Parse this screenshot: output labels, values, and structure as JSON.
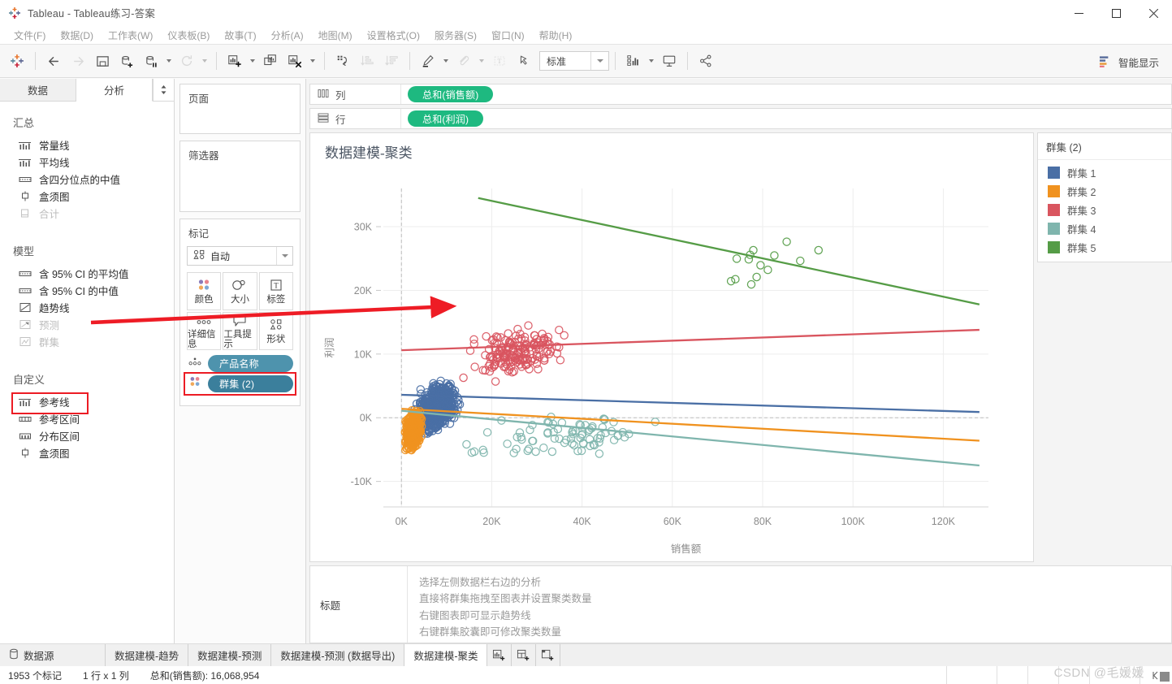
{
  "window": {
    "title": "Tableau - Tableau练习-答案",
    "app_icon": "tableau-icon",
    "minimize": "─",
    "maximize": "☐",
    "close": "✕"
  },
  "menu": [
    {
      "label": "文件(F)"
    },
    {
      "label": "数据(D)"
    },
    {
      "label": "工作表(W)"
    },
    {
      "label": "仪表板(B)"
    },
    {
      "label": "故事(T)"
    },
    {
      "label": "分析(A)"
    },
    {
      "label": "地图(M)"
    },
    {
      "label": "设置格式(O)"
    },
    {
      "label": "服务器(S)"
    },
    {
      "label": "窗口(N)"
    },
    {
      "label": "帮助(H)"
    }
  ],
  "toolbar": {
    "fit_value": "标准",
    "show_me_label": "智能显示",
    "buttons": [
      {
        "name": "tableau-home-icon"
      },
      {
        "name": "undo-icon"
      },
      {
        "name": "redo-icon"
      },
      {
        "name": "save-icon"
      },
      {
        "name": "new-data-source-icon"
      },
      {
        "name": "pause-refresh-icon"
      },
      {
        "name": "refresh-icon"
      },
      {
        "name": "new-worksheet-icon"
      },
      {
        "name": "duplicate-sheet-icon"
      },
      {
        "name": "clear-sheet-icon"
      },
      {
        "name": "swap-axes-icon"
      },
      {
        "name": "sort-ascending-icon"
      },
      {
        "name": "sort-descending-icon"
      },
      {
        "name": "highlight-icon"
      },
      {
        "name": "group-icon"
      },
      {
        "name": "show-labels-icon"
      },
      {
        "name": "fix-axes-icon"
      },
      {
        "name": "presentation-mode-icon"
      },
      {
        "name": "share-icon"
      }
    ]
  },
  "left_pane": {
    "tabs": [
      {
        "label": "数据"
      },
      {
        "label": "分析"
      }
    ],
    "active_tab": "分析",
    "sections": [
      {
        "title": "汇总",
        "items": [
          {
            "label": "常量线",
            "icon": "constant-line-icon",
            "disabled": false
          },
          {
            "label": "平均线",
            "icon": "average-line-icon",
            "disabled": false
          },
          {
            "label": "含四分位点的中值",
            "icon": "median-quartiles-icon",
            "disabled": false
          },
          {
            "label": "盒须图",
            "icon": "box-plot-icon",
            "disabled": false
          },
          {
            "label": "合计",
            "icon": "totals-icon",
            "disabled": true
          }
        ]
      },
      {
        "title": "模型",
        "items": [
          {
            "label": "含 95% CI 的平均值",
            "icon": "average-ci-icon",
            "disabled": false
          },
          {
            "label": "含 95% CI 的中值",
            "icon": "median-ci-icon",
            "disabled": false
          },
          {
            "label": "趋势线",
            "icon": "trend-line-icon",
            "disabled": false
          },
          {
            "label": "预测",
            "icon": "forecast-icon",
            "disabled": true
          },
          {
            "label": "群集",
            "icon": "cluster-icon",
            "disabled": true,
            "highlighted": true
          }
        ]
      },
      {
        "title": "自定义",
        "items": [
          {
            "label": "参考线",
            "icon": "reference-line-icon",
            "disabled": false
          },
          {
            "label": "参考区间",
            "icon": "reference-band-icon",
            "disabled": false
          },
          {
            "label": "分布区间",
            "icon": "distribution-band-icon",
            "disabled": false
          },
          {
            "label": "盒须图",
            "icon": "box-plot-icon",
            "disabled": false
          }
        ]
      }
    ]
  },
  "cards": {
    "pages": {
      "title": "页面"
    },
    "filters": {
      "title": "筛选器"
    },
    "marks": {
      "title": "标记",
      "mark_type": "自动",
      "mark_type_icon": "automatic-marks-icon",
      "buttons": [
        {
          "label": "颜色",
          "icon": "color-icon"
        },
        {
          "label": "大小",
          "icon": "size-icon"
        },
        {
          "label": "标签",
          "icon": "label-icon"
        },
        {
          "label": "详细信息",
          "icon": "detail-icon"
        },
        {
          "label": "工具提示",
          "icon": "tooltip-icon"
        },
        {
          "label": "形状",
          "icon": "shape-icon"
        }
      ],
      "pills": [
        {
          "label": "产品名称",
          "icon": "detail-icon",
          "highlighted": false
        },
        {
          "label": "群集 (2)",
          "icon": "color-icon",
          "highlighted": true
        }
      ]
    }
  },
  "shelves": {
    "columns": {
      "label": "列",
      "icon": "columns-icon",
      "pills": [
        "总和(销售额)"
      ]
    },
    "rows": {
      "label": "行",
      "icon": "rows-icon",
      "pills": [
        "总和(利润)"
      ]
    }
  },
  "legend": {
    "title": "群集 (2)",
    "items": [
      {
        "label": "群集 1",
        "color": "#4a6fa5"
      },
      {
        "label": "群集 2",
        "color": "#f0921f"
      },
      {
        "label": "群集 3",
        "color": "#d9555f"
      },
      {
        "label": "群集 4",
        "color": "#7fb5ad"
      },
      {
        "label": "群集 5",
        "color": "#559c46"
      }
    ]
  },
  "caption": {
    "label": "标题",
    "lines": [
      "选择左侧数据栏右边的分析",
      "直接将群集拖拽至图表并设置聚类数量",
      "右键图表即可显示趋势线",
      "右键群集胶囊即可修改聚类数量"
    ]
  },
  "bottom_tabs": {
    "data_source": {
      "label": "数据源",
      "icon": "data-source-icon"
    },
    "sheets": [
      {
        "label": "数据建模-趋势",
        "active": false
      },
      {
        "label": "数据建模-预测",
        "active": false
      },
      {
        "label": "数据建模-预测 (数据导出)",
        "active": false
      },
      {
        "label": "数据建模-聚类",
        "active": true
      }
    ],
    "new_buttons": [
      {
        "name": "new-worksheet-tab-icon"
      },
      {
        "name": "new-dashboard-tab-icon"
      },
      {
        "name": "new-story-tab-icon"
      }
    ]
  },
  "status_bar": {
    "marks": "1953 个标记",
    "dimensions": "1 行 x 1 列",
    "aggregate": "总和(销售额): 16,068,954"
  },
  "watermark": "CSDN @毛媛媛",
  "annotations": {
    "arrow_color": "#ee1c25",
    "highlight_color": "#ec1c24"
  },
  "chart_data": {
    "type": "scatter",
    "title": "数据建模-聚类",
    "xlabel": "销售额",
    "ylabel": "利润",
    "xlim": [
      -4000,
      130000
    ],
    "ylim": [
      -14000,
      36000
    ],
    "xticks": [
      "0K",
      "20K",
      "40K",
      "60K",
      "80K",
      "100K",
      "120K"
    ],
    "xtick_values": [
      0,
      20000,
      40000,
      60000,
      80000,
      100000,
      120000
    ],
    "yticks": [
      "-10K",
      "0K",
      "10K",
      "20K",
      "30K"
    ],
    "ytick_values": [
      -10000,
      0,
      10000,
      20000,
      30000
    ],
    "grid": true,
    "legend_position": "right",
    "marker": "open-circle",
    "series": [
      {
        "name": "群集 1",
        "color": "#4a6fa5",
        "n_points": 620,
        "x_range": [
          200,
          22000
        ],
        "y_range": [
          -7000,
          10500
        ],
        "centroid": [
          8000,
          1800
        ],
        "trend_line": {
          "x0": 0,
          "y0": 3600,
          "x1": 128000,
          "y1": 900
        }
      },
      {
        "name": "群集 2",
        "color": "#f0921f",
        "n_points": 430,
        "x_range": [
          100,
          9000
        ],
        "y_range": [
          -10500,
          3200
        ],
        "centroid": [
          2600,
          -2000
        ],
        "trend_line": {
          "x0": 0,
          "y0": 1400,
          "x1": 128000,
          "y1": -3600
        }
      },
      {
        "name": "群集 3",
        "color": "#d9555f",
        "n_points": 170,
        "x_range": [
          8000,
          62000
        ],
        "y_range": [
          1500,
          19500
        ],
        "centroid": [
          26000,
          10500
        ],
        "trend_line": {
          "x0": 0,
          "y0": 10600,
          "x1": 128000,
          "y1": 13800
        }
      },
      {
        "name": "群集 4",
        "color": "#7fb5ad",
        "n_points": 80,
        "x_range": [
          9000,
          105000
        ],
        "y_range": [
          -11500,
          6500
        ],
        "centroid": [
          34000,
          -3000
        ],
        "trend_line": {
          "x0": 0,
          "y0": 1100,
          "x1": 128000,
          "y1": -7500
        }
      },
      {
        "name": "群集 5",
        "color": "#559c46",
        "n_points": 14,
        "x_range": [
          54000,
          112000
        ],
        "y_range": [
          10500,
          33500
        ],
        "centroid": [
          80000,
          24000
        ],
        "trend_line": {
          "x0": 17000,
          "y0": 34500,
          "x1": 128000,
          "y1": 17800
        }
      }
    ],
    "zero_reference_line": {
      "axis": "y",
      "value": 0,
      "style": "dashed"
    },
    "zero_reference_line_x": {
      "axis": "x",
      "value": 0,
      "style": "dashed"
    }
  }
}
